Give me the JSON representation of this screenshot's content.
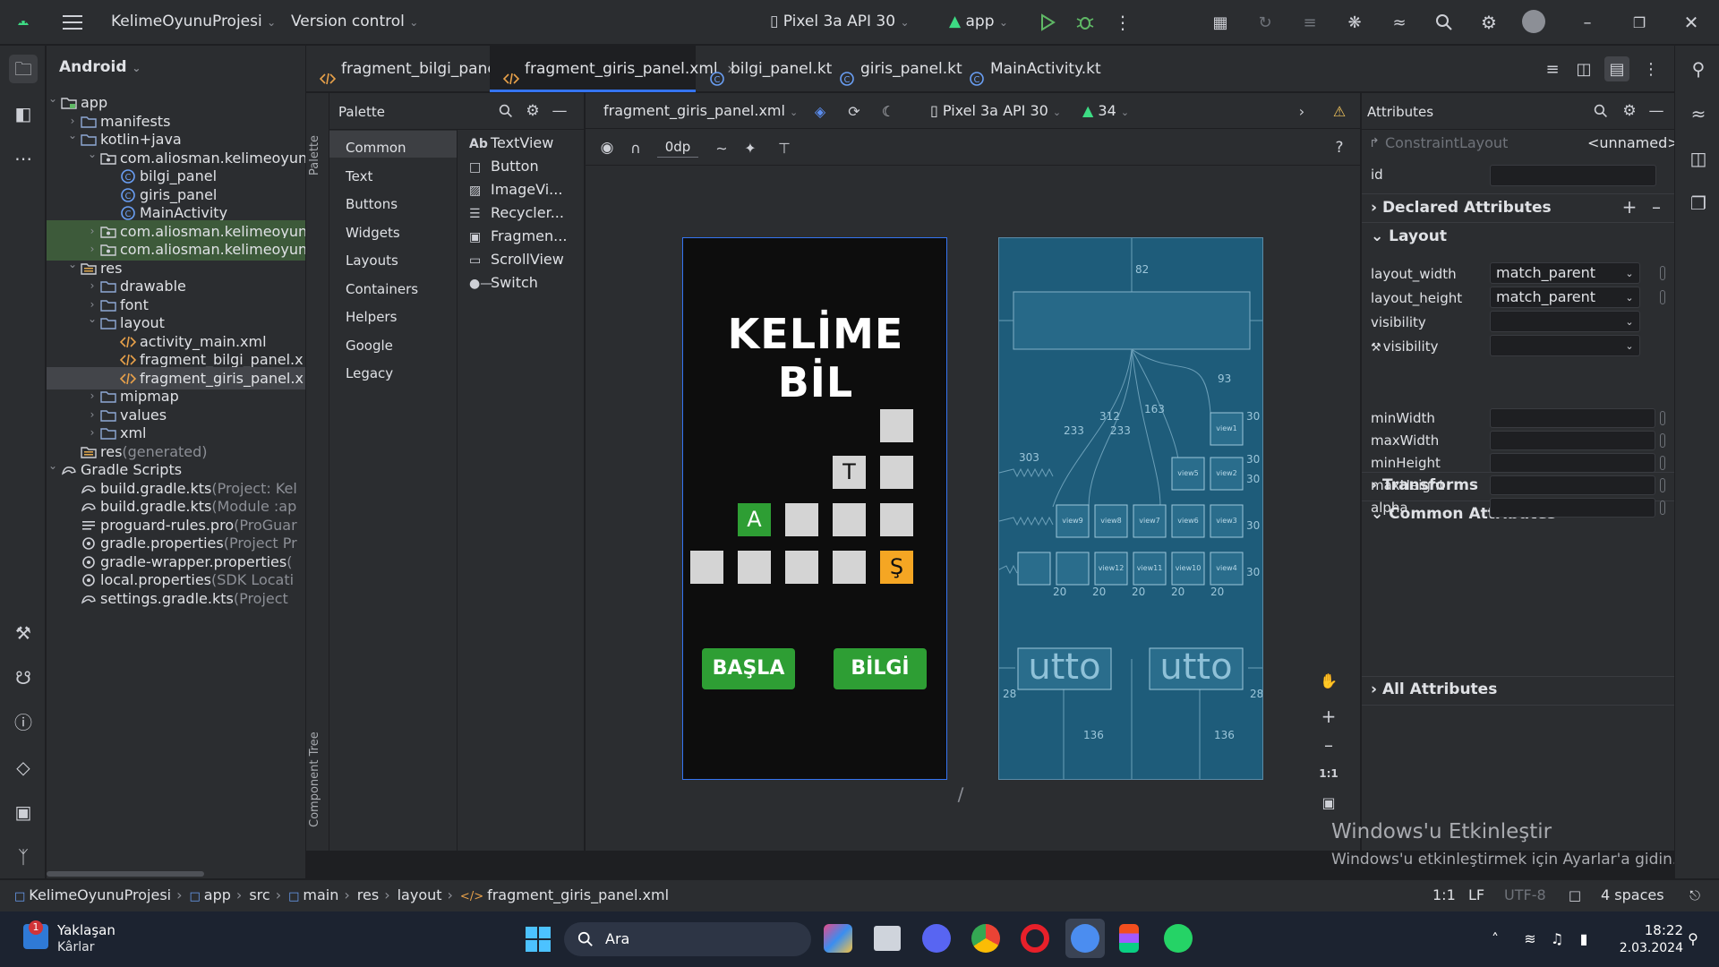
{
  "titlebar": {
    "project_name": "KelimeOyunuProjesi",
    "vcs": "Version control",
    "device": "Pixel 3a API 30",
    "run_config": "app"
  },
  "project_panel": {
    "view_mode": "Android",
    "tree": [
      {
        "label": "app",
        "extra": "",
        "depth": 0,
        "icon": "folder-module-icon",
        "expanded": true
      },
      {
        "label": "manifests",
        "extra": "",
        "depth": 1,
        "icon": "folder-icon",
        "expanded": false
      },
      {
        "label": "kotlin+java",
        "extra": "",
        "depth": 1,
        "icon": "folder-icon",
        "expanded": true
      },
      {
        "label": "com.aliosman.kelimeoyun",
        "extra": "",
        "depth": 2,
        "icon": "package-icon",
        "expanded": true
      },
      {
        "label": "bilgi_panel",
        "extra": "",
        "depth": 3,
        "icon": "kotlin-class-icon",
        "expanded": null
      },
      {
        "label": "giris_panel",
        "extra": "",
        "depth": 3,
        "icon": "kotlin-class-icon",
        "expanded": null
      },
      {
        "label": "MainActivity",
        "extra": "",
        "depth": 3,
        "icon": "kotlin-class-icon",
        "expanded": null
      },
      {
        "label": "com.aliosman.kelimeoyun",
        "extra": "",
        "depth": 2,
        "icon": "package-icon",
        "expanded": false
      },
      {
        "label": "com.aliosman.kelimeoyun",
        "extra": "",
        "depth": 2,
        "icon": "package-icon",
        "expanded": false
      },
      {
        "label": "res",
        "extra": "",
        "depth": 1,
        "icon": "folder-res-icon",
        "expanded": true
      },
      {
        "label": "drawable",
        "extra": "",
        "depth": 2,
        "icon": "folder-icon",
        "expanded": false
      },
      {
        "label": "font",
        "extra": "",
        "depth": 2,
        "icon": "folder-icon",
        "expanded": false
      },
      {
        "label": "layout",
        "extra": "",
        "depth": 2,
        "icon": "folder-icon",
        "expanded": true
      },
      {
        "label": "activity_main.xml",
        "extra": "",
        "depth": 3,
        "icon": "xml-file-icon",
        "expanded": null
      },
      {
        "label": "fragment_bilgi_panel.x",
        "extra": "",
        "depth": 3,
        "icon": "xml-file-icon",
        "expanded": null
      },
      {
        "label": "fragment_giris_panel.x",
        "extra": "",
        "depth": 3,
        "icon": "xml-file-icon",
        "expanded": null
      },
      {
        "label": "mipmap",
        "extra": "",
        "depth": 2,
        "icon": "folder-icon",
        "expanded": false
      },
      {
        "label": "values",
        "extra": "",
        "depth": 2,
        "icon": "folder-icon",
        "expanded": false
      },
      {
        "label": "xml",
        "extra": "",
        "depth": 2,
        "icon": "folder-icon",
        "expanded": false
      },
      {
        "label": "res",
        "extra": "(generated)",
        "depth": 1,
        "icon": "folder-res-icon",
        "expanded": null
      },
      {
        "label": "Gradle Scripts",
        "extra": "",
        "depth": 0,
        "icon": "gradle-icon",
        "expanded": true
      },
      {
        "label": "build.gradle.kts",
        "extra": "(Project: Kel",
        "depth": 1,
        "icon": "gradle-file-icon",
        "expanded": null
      },
      {
        "label": "build.gradle.kts",
        "extra": "(Module :ap",
        "depth": 1,
        "icon": "gradle-file-icon",
        "expanded": null
      },
      {
        "label": "proguard-rules.pro",
        "extra": "(ProGuar",
        "depth": 1,
        "icon": "text-file-icon",
        "expanded": null
      },
      {
        "label": "gradle.properties",
        "extra": "(Project Pr",
        "depth": 1,
        "icon": "settings-file-icon",
        "expanded": null
      },
      {
        "label": "gradle-wrapper.properties",
        "extra": "(",
        "depth": 1,
        "icon": "settings-file-icon",
        "expanded": null
      },
      {
        "label": "local.properties",
        "extra": "(SDK Locati",
        "depth": 1,
        "icon": "settings-file-icon",
        "expanded": null
      },
      {
        "label": "settings.gradle.kts",
        "extra": "(Project",
        "depth": 1,
        "icon": "gradle-file-icon",
        "expanded": null
      }
    ]
  },
  "tabs": [
    {
      "label": "fragment_bilgi_panel.xml",
      "icon": "xml-file-icon",
      "active": false
    },
    {
      "label": "fragment_giris_panel.xml",
      "icon": "xml-file-icon",
      "active": true
    },
    {
      "label": "bilgi_panel.kt",
      "icon": "kotlin-class-icon",
      "active": false
    },
    {
      "label": "giris_panel.kt",
      "icon": "kotlin-class-icon",
      "active": false
    },
    {
      "label": "MainActivity.kt",
      "icon": "kotlin-class-icon",
      "active": false
    }
  ],
  "palette": {
    "title": "Palette",
    "categories": [
      "Common",
      "Text",
      "Buttons",
      "Widgets",
      "Layouts",
      "Containers",
      "Helpers",
      "Google",
      "Legacy"
    ],
    "items": [
      "TextView",
      "Button",
      "ImageVi...",
      "Recycler...",
      "Fragmen...",
      "ScrollView",
      "Switch"
    ],
    "textview_prefix": "Ab",
    "side_labels": {
      "palette": "Palette",
      "component_tree": "Component Tree"
    }
  },
  "design_toolbar": {
    "file": "fragment_giris_panel.xml",
    "device": "Pixel 3a API 30",
    "api": "34",
    "margin": "0dp"
  },
  "preview": {
    "title": "KELİME BİL",
    "grid_rows": [
      [
        {
          "text": "",
          "color": "#d4d4d4"
        }
      ],
      [
        {
          "text": "T",
          "color": "#d4d4d4"
        },
        {
          "text": "",
          "color": "#d4d4d4"
        }
      ],
      [
        {
          "text": "A",
          "color": "#2e9e34"
        },
        {
          "text": "",
          "color": "#d4d4d4"
        },
        {
          "text": "",
          "color": "#d4d4d4"
        },
        {
          "text": "",
          "color": "#d4d4d4"
        }
      ],
      [
        {
          "text": "",
          "color": "#d4d4d4"
        },
        {
          "text": "",
          "color": "#d4d4d4"
        },
        {
          "text": "",
          "color": "#d4d4d4"
        },
        {
          "text": "",
          "color": "#d4d4d4"
        },
        {
          "text": "Ş",
          "color": "#f5a623"
        }
      ]
    ],
    "button_start": "BAŞLA",
    "button_info": "BİLGİ",
    "button_color": "#2e9e34"
  },
  "blueprint": {
    "margins": [
      "82",
      "93",
      "303",
      "233",
      "312",
      "233",
      "163",
      "30",
      "30",
      "30",
      "30",
      "30",
      "20",
      "20",
      "20",
      "20",
      "20",
      "28",
      "28",
      "136",
      "136"
    ],
    "view_labels": [
      "view1",
      "view2",
      "view3",
      "view4",
      "view5",
      "view6",
      "view7",
      "view8",
      "view9",
      "view10",
      "view11",
      "view12"
    ],
    "button_text": "utto"
  },
  "zoom_controls": {
    "fit": "1:1"
  },
  "attributes": {
    "title": "Attributes",
    "component": "ConstraintLayout",
    "component_id_value": "<unnamed>",
    "id_label": "id",
    "id_value": "",
    "sections": {
      "declared": "Declared Attributes",
      "layout": "Layout",
      "transforms": "Transforms",
      "common": "Common Attributes",
      "all": "All Attributes"
    },
    "layout_rows": [
      {
        "label": "layout_width",
        "value": "match_parent"
      },
      {
        "label": "layout_height",
        "value": "match_parent"
      },
      {
        "label": "visibility",
        "value": ""
      },
      {
        "label": "visibility",
        "value": ""
      }
    ],
    "common_rows": [
      {
        "label": "minWidth",
        "value": ""
      },
      {
        "label": "maxWidth",
        "value": ""
      },
      {
        "label": "minHeight",
        "value": ""
      },
      {
        "label": "maxHeight",
        "value": ""
      },
      {
        "label": "alpha",
        "value": ""
      }
    ]
  },
  "watermark": {
    "line1": "Windows'u Etkinleştir",
    "line2": "Windows'u etkinleştirmek için Ayarlar'a gidin."
  },
  "breadcrumbs": [
    "KelimeOyunuProjesi",
    "app",
    "src",
    "main",
    "res",
    "layout",
    "fragment_giris_panel.xml"
  ],
  "status_right": {
    "position": "1:1",
    "line_sep": "LF",
    "encoding": "UTF-8",
    "indent": "4 spaces"
  },
  "taskbar": {
    "weather_title": "Yaklaşan",
    "weather_sub": "Kârlar",
    "weather_badge": "1",
    "search_placeholder": "Ara",
    "time": "18:22",
    "date": "2.03.2024"
  },
  "colors": {
    "accent": "#3574f0",
    "bg_dark": "#1e1f22",
    "panel": "#2b2d30",
    "blueprint": "#1e5c7a",
    "highlight_row": "#3d5a3a"
  }
}
